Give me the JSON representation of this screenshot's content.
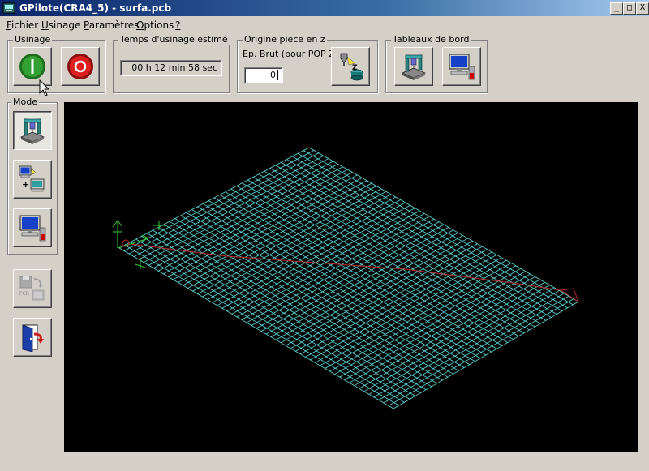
{
  "window": {
    "title": "GPilote(CRA4_5) - surfa.pcb",
    "minimize": "_",
    "maximize": "□",
    "close": "X"
  },
  "menu": [
    {
      "underline": "F",
      "rest": "ichier"
    },
    {
      "underline": "U",
      "rest": "sinage"
    },
    {
      "underline": "P",
      "rest": "aramètres"
    },
    {
      "underline": "O",
      "rest": "ptions"
    },
    {
      "underline": "?",
      "rest": ""
    }
  ],
  "usinage": {
    "label": "Usinage"
  },
  "temps": {
    "label": "Temps d'usinage estimé",
    "value": "00 h 12 min 58 sec"
  },
  "origine": {
    "label": "Origine piece en z",
    "ep_label": "Ep. Brut (pour POP Z)",
    "ep_value": "0"
  },
  "tableaux": {
    "label": "Tableaux de bord"
  },
  "mode": {
    "label": "Mode"
  },
  "colors": {
    "grid": "#5fe0e0",
    "toolpath": "#c0282a",
    "axis": "#33cc33",
    "start_green": "#2e8b2e",
    "stop_red": "#cc1a1a"
  }
}
